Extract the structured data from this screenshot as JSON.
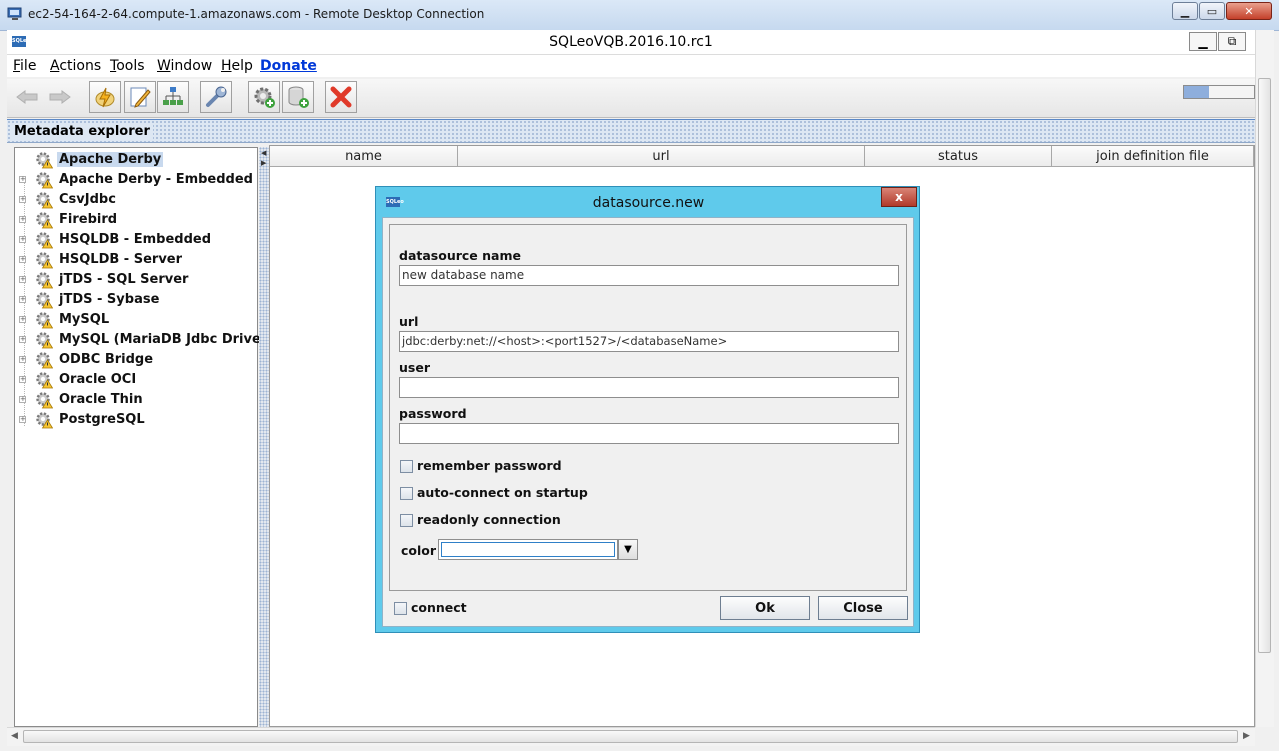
{
  "rdp": {
    "title": "ec2-54-164-2-64.compute-1.amazonaws.com - Remote Desktop Connection"
  },
  "app": {
    "icon_text": "SQLeo",
    "title": "SQLeoVQB.2016.10.rc1"
  },
  "menu": {
    "file": "File",
    "actions": "Actions",
    "tools": "Tools",
    "window": "Window",
    "help": "Help",
    "donate": "Donate"
  },
  "toolbar": {
    "progress": 0.35
  },
  "explorer": {
    "title": "Metadata explorer",
    "items": [
      "Apache Derby",
      "Apache Derby - Embedded",
      "CsvJdbc",
      "Firebird",
      "HSQLDB - Embedded",
      "HSQLDB - Server",
      "jTDS - SQL Server",
      "jTDS - Sybase",
      "MySQL",
      "MySQL (MariaDB Jdbc Driver)",
      "ODBC Bridge",
      "Oracle OCI",
      "Oracle Thin",
      "PostgreSQL"
    ]
  },
  "table": {
    "columns": [
      "name",
      "url",
      "status",
      "join definition file"
    ]
  },
  "dialog": {
    "title": "datasource.new",
    "close": "x",
    "name_label": "datasource name",
    "name_value": "new database name",
    "url_label": "url",
    "url_value": "jdbc:derby:net://<host>:<port1527>/<databaseName>",
    "user_label": "user",
    "user_value": "",
    "password_label": "password",
    "password_value": "",
    "remember_label": "remember password",
    "autoconnect_label": "auto-connect on startup",
    "readonly_label": "readonly connection",
    "color_label": "color",
    "connect_label": "connect",
    "ok_label": "Ok",
    "close_label": "Close"
  },
  "colors": {
    "dialog_frame": "#5fcaeb",
    "selection": "#c8d9ee",
    "donate_link": "#0038d8"
  }
}
